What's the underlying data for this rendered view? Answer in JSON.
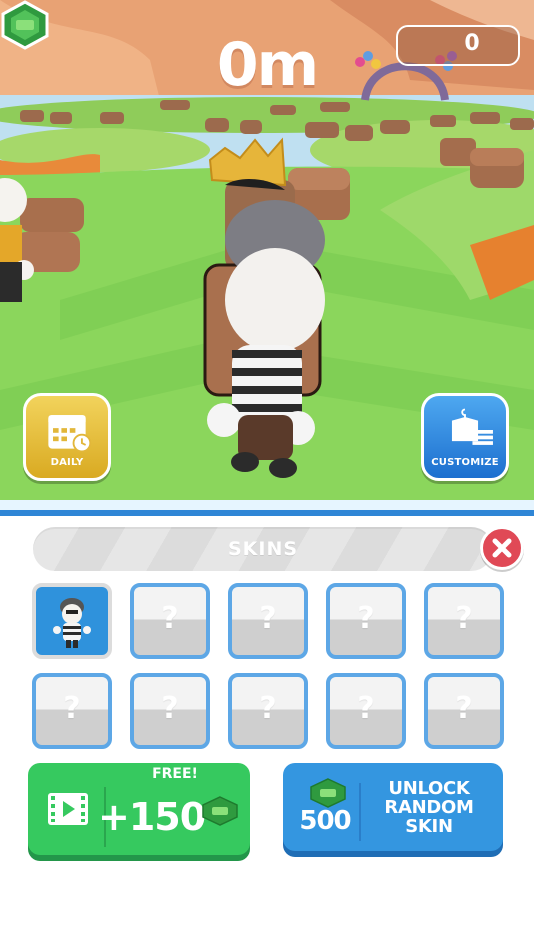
{
  "hud": {
    "distance": "0m",
    "currency_count": "0",
    "gem_icon": "cash-gem-icon"
  },
  "buttons": {
    "daily_label": "DAILY",
    "customize_label": "CUSTOMIZE"
  },
  "skins_panel": {
    "title": "SKINS",
    "locked_symbol": "?",
    "tiles": [
      {
        "state": "selected",
        "skin": "robber"
      },
      {
        "state": "locked"
      },
      {
        "state": "locked"
      },
      {
        "state": "locked"
      },
      {
        "state": "locked"
      },
      {
        "state": "locked"
      },
      {
        "state": "locked"
      },
      {
        "state": "locked"
      },
      {
        "state": "locked"
      },
      {
        "state": "locked"
      }
    ],
    "free_button": {
      "label": "FREE!",
      "amount": "+150"
    },
    "unlock_button": {
      "price": "500",
      "line1": "UNLOCK",
      "line2": "RANDOM",
      "line3": "SKIN"
    }
  },
  "colors": {
    "panel_border": "#2f86d6",
    "free_green": "#36c95f",
    "unlock_blue": "#3496e0",
    "close_red": "#e04956",
    "tile_border": "#5da7e6"
  }
}
